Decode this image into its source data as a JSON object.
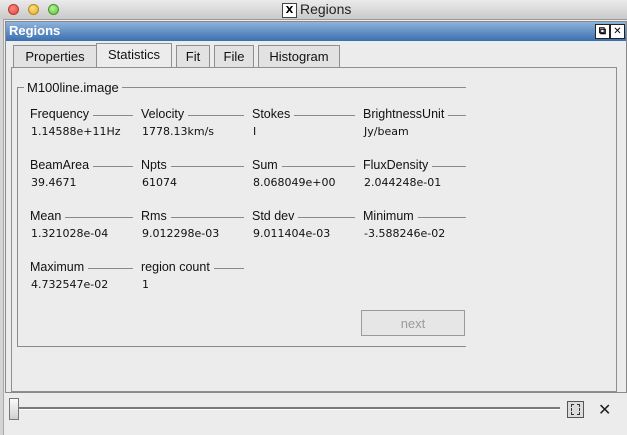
{
  "window": {
    "title": "Regions"
  },
  "dock": {
    "title": "Regions"
  },
  "tabs": [
    {
      "label": "Properties"
    },
    {
      "label": "Statistics"
    },
    {
      "label": "Fit"
    },
    {
      "label": "File"
    },
    {
      "label": "Histogram"
    }
  ],
  "group": {
    "title": "M100line.image",
    "fields": [
      {
        "label": "Frequency",
        "value": "1.14588e+11Hz"
      },
      {
        "label": "Velocity",
        "value": "1778.13km/s"
      },
      {
        "label": "Stokes",
        "value": "I"
      },
      {
        "label": "BrightnessUnit",
        "value": "Jy/beam"
      },
      {
        "label": "BeamArea",
        "value": "39.4671"
      },
      {
        "label": "Npts",
        "value": "61074"
      },
      {
        "label": "Sum",
        "value": "8.068049e+00"
      },
      {
        "label": "FluxDensity",
        "value": "2.044248e-01"
      },
      {
        "label": "Mean",
        "value": "1.321028e-04"
      },
      {
        "label": "Rms",
        "value": "9.012298e-03"
      },
      {
        "label": "Std dev",
        "value": "9.011404e-03"
      },
      {
        "label": "Minimum",
        "value": "-3.588246e-02"
      },
      {
        "label": "Maximum",
        "value": "4.732547e-02"
      },
      {
        "label": "region count",
        "value": "1"
      }
    ]
  },
  "buttons": {
    "next": "next"
  },
  "xserver_glyph": "X",
  "dock_buttons": {
    "float": "⧉",
    "close": "✕"
  },
  "bottom": {
    "close_glyph": "✕"
  }
}
